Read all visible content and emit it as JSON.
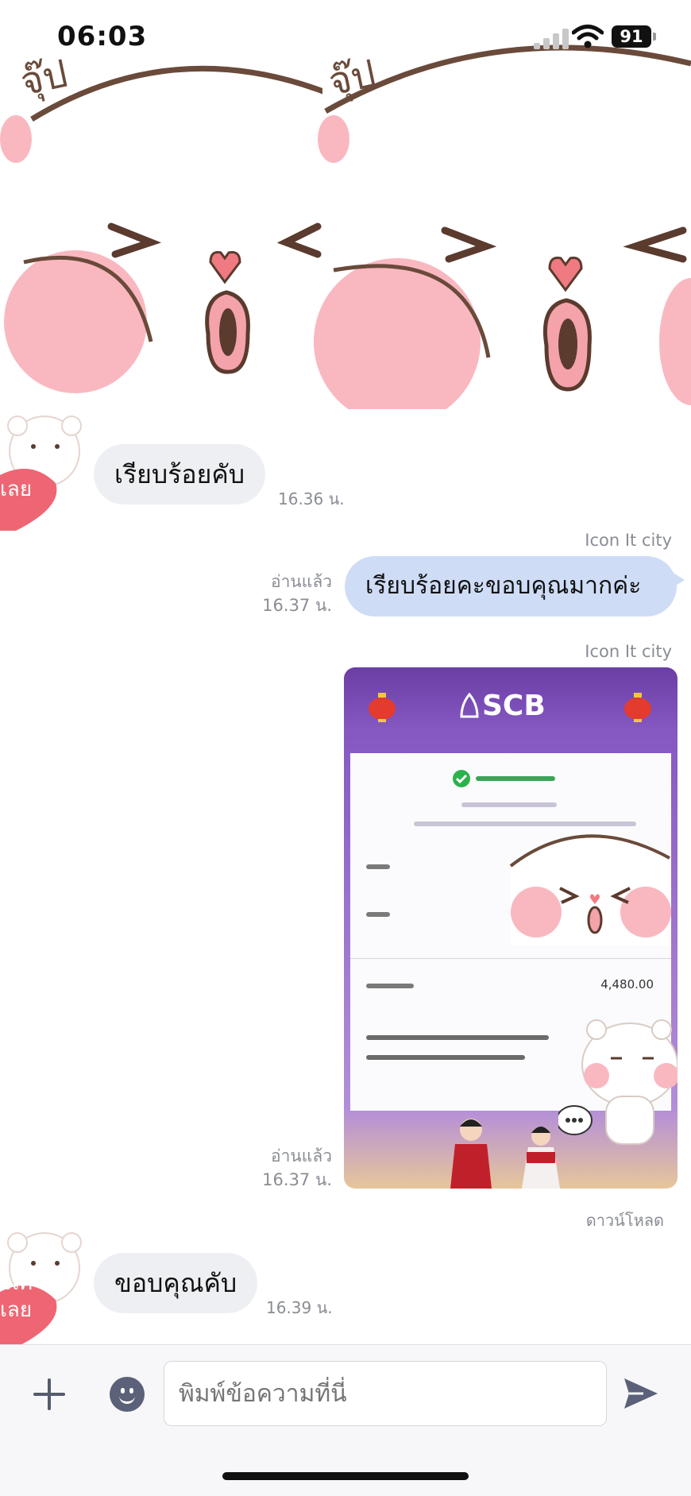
{
  "status_bar": {
    "time": "06:03",
    "battery": "91"
  },
  "sticker_top": {
    "caption": "จุ๊ป"
  },
  "messages": [
    {
      "kind": "incoming",
      "text": "เรียบร้อยคับ",
      "time": "16.36 น."
    },
    {
      "kind": "outgoing",
      "sender": "Icon It city",
      "text": "เรียบร้อยคะขอบคุณมากค่ะ",
      "read_label": "อ่านแล้ว",
      "time": "16.37 น."
    },
    {
      "kind": "outgoing-image",
      "sender": "Icon It city",
      "read_label": "อ่านแล้ว",
      "time": "16.37 น.",
      "download_label": "ดาวน์โหลด",
      "bank_name": "SCB",
      "amount": "4,480.00"
    },
    {
      "kind": "incoming",
      "text": "ขอบคุณคับ",
      "time": "16.39 น."
    }
  ],
  "avatar": {
    "text_line1": "จเค้า",
    "text_line2": "เลย"
  },
  "composer": {
    "placeholder": "พิมพ์ข้อความที่นี่"
  },
  "colors": {
    "incoming_bubble": "#eeeff3",
    "outgoing_bubble": "#cfdcf6",
    "accent_purple": "#6a3ea4"
  },
  "icons": [
    "signal-icon",
    "wifi-icon",
    "plus-icon",
    "emoji-icon",
    "send-icon"
  ]
}
